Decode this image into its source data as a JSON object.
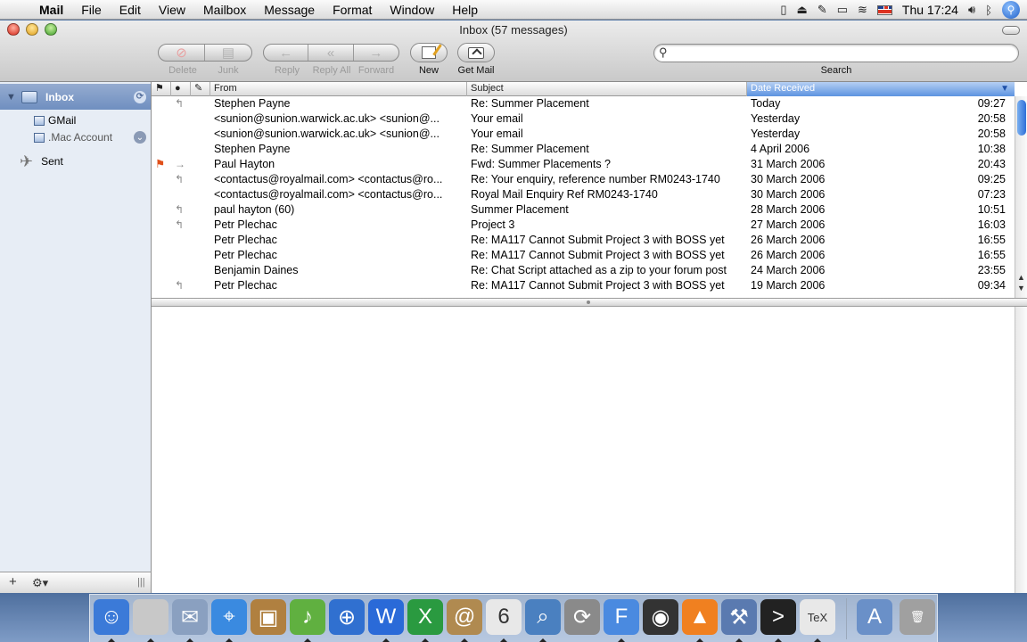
{
  "menubar": {
    "items": [
      "Mail",
      "File",
      "Edit",
      "View",
      "Mailbox",
      "Message",
      "Format",
      "Window",
      "Help"
    ],
    "clock": "Thu 17:24"
  },
  "window": {
    "title": "Inbox (57 messages)"
  },
  "toolbar": {
    "delete_label": "Delete",
    "junk_label": "Junk",
    "reply_label": "Reply",
    "reply_all_label": "Reply All",
    "forward_label": "Forward",
    "new_label": "New",
    "get_mail_label": "Get Mail",
    "search_label": "Search",
    "search_value": ""
  },
  "sidebar": {
    "inbox_label": "Inbox",
    "accounts": [
      {
        "label": "GMail"
      },
      {
        "label": ".Mac Account"
      }
    ],
    "sent_label": "Sent"
  },
  "list": {
    "columns": {
      "from": "From",
      "subject": "Subject",
      "date": "Date Received"
    },
    "rows": [
      {
        "flag": "",
        "status": "↰",
        "from": "Stephen Payne",
        "subject": "Re: Summer Placement",
        "date": "Today",
        "time": "09:27"
      },
      {
        "flag": "",
        "status": "",
        "from": "<sunion@sunion.warwick.ac.uk> <sunion@...",
        "subject": "Your email",
        "date": "Yesterday",
        "time": "20:58"
      },
      {
        "flag": "",
        "status": "",
        "from": "<sunion@sunion.warwick.ac.uk> <sunion@...",
        "subject": "Your email",
        "date": "Yesterday",
        "time": "20:58"
      },
      {
        "flag": "",
        "status": "",
        "from": "Stephen Payne",
        "subject": "Re: Summer Placement",
        "date": "4 April 2006",
        "time": "10:38"
      },
      {
        "flag": "⚑",
        "status": "→",
        "from": "Paul Hayton",
        "subject": "Fwd: Summer Placements ?",
        "date": "31 March 2006",
        "time": "20:43"
      },
      {
        "flag": "",
        "status": "↰",
        "from": "<contactus@royalmail.com> <contactus@ro...",
        "subject": "Re: Your enquiry, reference number RM0243-1740",
        "date": "30 March 2006",
        "time": "09:25"
      },
      {
        "flag": "",
        "status": "",
        "from": "<contactus@royalmail.com> <contactus@ro...",
        "subject": "Royal Mail Enquiry Ref RM0243-1740",
        "date": "30 March 2006",
        "time": "07:23"
      },
      {
        "flag": "",
        "status": "↰",
        "from": "paul hayton (60)",
        "subject": "Summer Placement",
        "date": "28 March 2006",
        "time": "10:51"
      },
      {
        "flag": "",
        "status": "↰",
        "from": "Petr Plechac",
        "subject": "Project 3",
        "date": "27 March 2006",
        "time": "16:03"
      },
      {
        "flag": "",
        "status": "",
        "from": "Petr Plechac",
        "subject": "Re: MA117 Cannot Submit Project 3 with BOSS yet",
        "date": "26 March 2006",
        "time": "16:55"
      },
      {
        "flag": "",
        "status": "",
        "from": "Petr Plechac",
        "subject": "Re: MA117 Cannot Submit Project 3 with BOSS yet",
        "date": "26 March 2006",
        "time": "16:55"
      },
      {
        "flag": "",
        "status": "",
        "from": "Benjamin Daines",
        "subject": "Re: Chat Script attached as a zip to your forum post",
        "date": "24 March 2006",
        "time": "23:55"
      },
      {
        "flag": "",
        "status": "↰",
        "from": "Petr Plechac",
        "subject": "Re: MA117 Cannot Submit Project 3 with BOSS yet",
        "date": "19 March 2006",
        "time": "09:34"
      }
    ]
  },
  "dock": {
    "icons": [
      "finder-icon",
      "system-info-icon",
      "mail-icon",
      "safari-icon",
      "iphoto-icon",
      "itunes-icon",
      "network-icon",
      "word-icon",
      "excel-icon",
      "address-book-icon",
      "ical-icon",
      "preview-icon",
      "sync-icon",
      "firefox-icon",
      "blowfish-icon",
      "vlc-icon",
      "xcode-icon",
      "terminal-icon",
      "latex-icon",
      "applications-folder-icon",
      "trash-icon"
    ]
  },
  "colors": {
    "selection_blue": "#6f8fc0",
    "sort_header_blue": "#5d93e0",
    "flag_orange": "#e0501a"
  }
}
